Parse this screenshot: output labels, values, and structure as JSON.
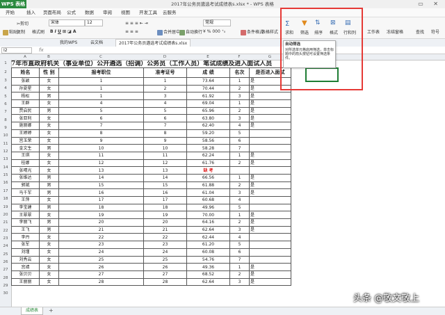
{
  "titlebar": {
    "app": "WPS 表格",
    "doc_title": "2017年公务员遴选考试成绩表s.xlsx * - WPS 表格"
  },
  "menu": [
    "开始",
    "插入",
    "页面布局",
    "公式",
    "数据",
    "审阅",
    "视图",
    "开发工具",
    "云服务"
  ],
  "ribbon": {
    "paste": "粘贴",
    "cut": "剪切",
    "copy": "复制",
    "format_painter": "格式刷",
    "font": "宋体",
    "size": "12",
    "merge": "合并居中",
    "wrap": "自动换行",
    "numfmt": "常规",
    "cond": "条件格式",
    "table_style": "表格样式",
    "symbol": "符号",
    "sum": "求和",
    "filter": "筛选",
    "sort": "排序",
    "format": "格式",
    "rowcol": "行和列",
    "sheet": "工作表",
    "freeze": "冻结窗格",
    "find": "查找",
    "symbol2": "符号"
  },
  "tabs": {
    "home": "我的WPS",
    "cloud": "云文档",
    "doc": "2017年公务员遴选考试成绩表s.xlsx"
  },
  "formula": {
    "cell": "I2",
    "fx": "fx"
  },
  "tooltip": {
    "title": "自动筛选",
    "body": "对所选单元格启用筛选，单击标题中的箭头按钮可设置筛选条件。"
  },
  "columns": [
    "A",
    "B",
    "C",
    "D",
    "E",
    "F",
    "G",
    "H"
  ],
  "sheet_title": "7年市直政府机关（事业单位）公开遴选（招调）公务员（工作人员）笔试成绩及进入面试人员",
  "header": [
    "姓名",
    "性 别",
    "报考职位",
    "准考证号",
    "成 绩",
    "名次",
    "是否进入面试"
  ],
  "rows": [
    [
      "张颖",
      "女",
      "1",
      "1",
      "73.64",
      "1",
      "是"
    ],
    [
      "孙夏星",
      "女",
      "1",
      "2",
      "70.44",
      "2",
      "是"
    ],
    [
      "杨松",
      "男",
      "1",
      "3",
      "61.92",
      "3",
      "是"
    ],
    [
      "王群",
      "女",
      "4",
      "4",
      "69.04",
      "1",
      "是"
    ],
    [
      "贾启民",
      "男",
      "5",
      "5",
      "65.96",
      "2",
      "是"
    ],
    [
      "张亚利",
      "女",
      "6",
      "6",
      "63.80",
      "3",
      "是"
    ],
    [
      "施丽娜",
      "女",
      "7",
      "7",
      "62.40",
      "4",
      "是"
    ],
    [
      "王婷婷",
      "女",
      "8",
      "8",
      "59.20",
      "5",
      ""
    ],
    [
      "宫玉荣",
      "女",
      "9",
      "9",
      "58.56",
      "6",
      ""
    ],
    [
      "金文生",
      "男",
      "10",
      "10",
      "58.28",
      "7",
      ""
    ],
    [
      "王琪",
      "女",
      "11",
      "11",
      "62.24",
      "1",
      "是"
    ],
    [
      "桂娜",
      "女",
      "12",
      "12",
      "61.76",
      "2",
      "是"
    ],
    [
      "张晴光",
      "女",
      "13",
      "13",
      "缺 考",
      "",
      ""
    ],
    [
      "张维达",
      "男",
      "14",
      "14",
      "66.56",
      "1",
      "是"
    ],
    [
      "郭斌",
      "男",
      "15",
      "15",
      "61.88",
      "2",
      "是"
    ],
    [
      "马千军",
      "男",
      "16",
      "16",
      "61.04",
      "3",
      "是"
    ],
    [
      "王萍",
      "女",
      "17",
      "17",
      "60.68",
      "4",
      ""
    ],
    [
      "李宝建",
      "男",
      "18",
      "18",
      "49.96",
      "5",
      ""
    ],
    [
      "王翠翠",
      "女",
      "19",
      "19",
      "70.00",
      "1",
      "是"
    ],
    [
      "李丽飞",
      "男",
      "20",
      "20",
      "64.16",
      "2",
      "是"
    ],
    [
      "王飞",
      "男",
      "21",
      "21",
      "62.64",
      "3",
      "是"
    ],
    [
      "李丹",
      "女",
      "22",
      "22",
      "62.44",
      "4",
      ""
    ],
    [
      "张军",
      "女",
      "23",
      "23",
      "61.20",
      "5",
      ""
    ],
    [
      "刘瑾",
      "女",
      "24",
      "24",
      "60.08",
      "6",
      ""
    ],
    [
      "刘秀云",
      "女",
      "25",
      "25",
      "54.76",
      "7",
      ""
    ],
    [
      "宫靖",
      "女",
      "26",
      "26",
      "49.36",
      "1",
      "是"
    ],
    [
      "张贝贝",
      "女",
      "27",
      "27",
      "68.52",
      "2",
      "是"
    ],
    [
      "王丽丽",
      "女",
      "28",
      "28",
      "62.64",
      "3",
      "是"
    ]
  ],
  "sheet_tab": "成绩表",
  "watermark": "头条 @敬文敬上",
  "colors": {
    "accent_red": "#e53935",
    "wps_green": "#2b8a3e",
    "absent_red": "#e02020"
  }
}
